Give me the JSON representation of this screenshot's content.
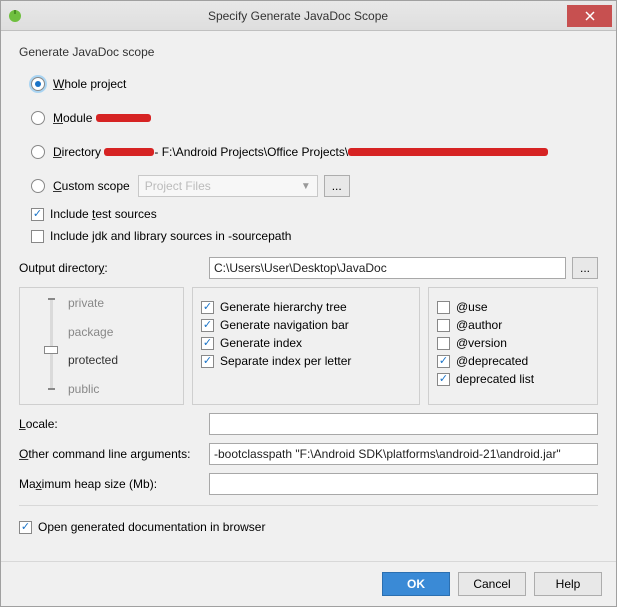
{
  "title": "Specify Generate JavaDoc Scope",
  "section_title": "Generate JavaDoc scope",
  "scope": {
    "whole_project": "Whole project",
    "module": "Module",
    "directory": "Directory",
    "directory_path_visible": "- F:\\Android Projects\\Office Projects\\",
    "custom_scope": "Custom scope",
    "custom_scope_dropdown": "Project Files",
    "ellipsis": "..."
  },
  "include_test": "Include test sources",
  "include_jdk": "Include jdk and library sources in -sourcepath",
  "output_dir_label": "Output directory:",
  "output_dir_value": "C:\\Users\\User\\Desktop\\JavaDoc",
  "visibility": {
    "private": "private",
    "package": "package",
    "protected": "protected",
    "public": "public"
  },
  "options": {
    "hierarchy": "Generate hierarchy tree",
    "navbar": "Generate navigation bar",
    "index": "Generate index",
    "sep_index": "Separate index per letter"
  },
  "tags": {
    "use": "@use",
    "author": "@author",
    "version": "@version",
    "deprecated": "@deprecated",
    "deprecated_list": "deprecated list"
  },
  "locale_label": "Locale:",
  "locale_value": "",
  "cmdline_label": "Other command line arguments:",
  "cmdline_value": "-bootclasspath \"F:\\Android SDK\\platforms\\android-21\\android.jar\"",
  "heap_label": "Maximum heap size (Mb):",
  "heap_value": "",
  "open_doc": "Open generated documentation in browser",
  "buttons": {
    "ok": "OK",
    "cancel": "Cancel",
    "help": "Help"
  }
}
